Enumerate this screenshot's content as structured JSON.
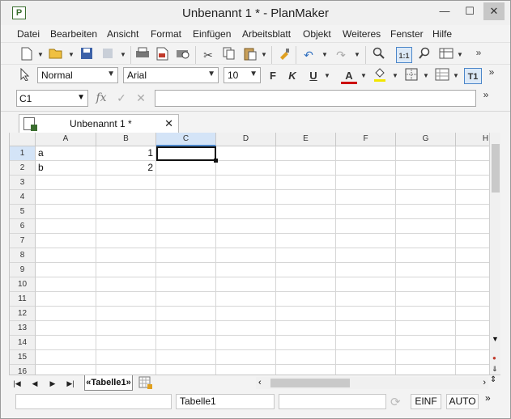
{
  "window": {
    "title": "Unbenannt 1 * - PlanMaker",
    "app_icon_letter": "P",
    "min": "—",
    "max": "☐",
    "close": "✕"
  },
  "menu": [
    "Datei",
    "Bearbeiten",
    "Ansicht",
    "Format",
    "Einfügen",
    "Arbeitsblatt",
    "Objekt",
    "Weiteres",
    "Fenster",
    "Hilfe"
  ],
  "toolbar": {
    "icons": [
      "new-document-icon",
      "open-folder-icon",
      "save-icon",
      "save-all-icon",
      "print-icon",
      "export-pdf-icon",
      "print-preview-icon",
      "cut-icon",
      "copy-icon",
      "paste-icon",
      "format-painter-icon",
      "undo-icon",
      "redo-icon",
      "search-icon",
      "actual-size-icon",
      "zoom-icon",
      "view-options-icon"
    ],
    "overflow": "»"
  },
  "formatbar": {
    "style_value": "Normal",
    "font_value": "Arial",
    "size_value": "10",
    "bold": "F",
    "italic": "K",
    "underline": "U",
    "font_color_letter": "A",
    "font_color": "#cc0000",
    "fill_color": "#f2e600",
    "t1_label": "T1",
    "overflow": "»"
  },
  "formula_bar": {
    "cell_ref": "C1",
    "fx": "fx",
    "confirm": "✓",
    "cancel": "✕",
    "value": "",
    "overflow": "»"
  },
  "document_tab": {
    "label": "Unbenannt 1 *",
    "close": "✕"
  },
  "grid": {
    "columns": [
      "A",
      "B",
      "C",
      "D",
      "E",
      "F",
      "G",
      "H"
    ],
    "selected_column": "C",
    "rows": [
      "1",
      "2",
      "3",
      "4",
      "5",
      "6",
      "7",
      "8",
      "9",
      "10",
      "11",
      "12",
      "13",
      "14",
      "15",
      "16"
    ],
    "selected_row": "1",
    "active_cell": "C1",
    "cells": [
      {
        "ref": "A1",
        "value": "a"
      },
      {
        "ref": "B1",
        "value": "1"
      },
      {
        "ref": "A2",
        "value": "b"
      },
      {
        "ref": "B2",
        "value": "2"
      }
    ]
  },
  "sheet_tabs": {
    "active_sheet": "«Tabelle1»",
    "nav": [
      "|◀",
      "◀",
      "▶",
      "▶|"
    ]
  },
  "status_bar": {
    "field1": "",
    "sheet_name": "Tabelle1",
    "field3": "",
    "insert_mode": "EINF",
    "calc_mode": "AUTO",
    "overflow": "»"
  }
}
